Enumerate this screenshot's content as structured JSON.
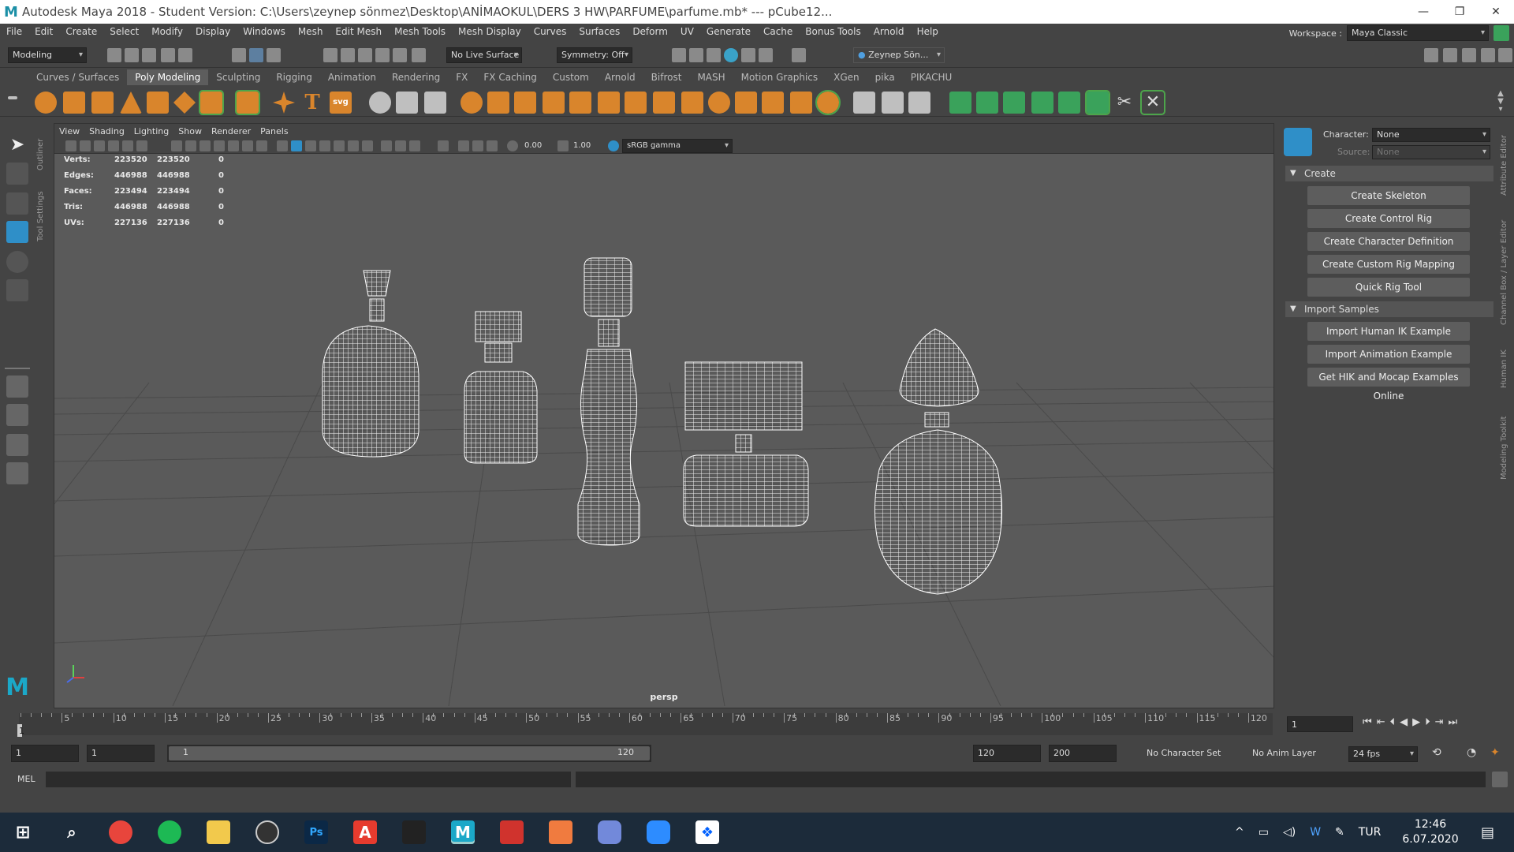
{
  "window": {
    "title": "Autodesk Maya 2018 - Student Version: C:\\Users\\zeynep sönmez\\Desktop\\ANİMAOKUL\\DERS 3 HW\\PARFUME\\parfume.mb*   ---   pCube12...",
    "logo": "M"
  },
  "menu": [
    "File",
    "Edit",
    "Create",
    "Select",
    "Modify",
    "Display",
    "Windows",
    "Mesh",
    "Edit Mesh",
    "Mesh Tools",
    "Mesh Display",
    "Curves",
    "Surfaces",
    "Deform",
    "UV",
    "Generate",
    "Cache",
    "Bonus Tools",
    "Arnold",
    "Help"
  ],
  "workspace": {
    "label": "Workspace :",
    "value": "Maya Classic"
  },
  "statusline": {
    "mode": "Modeling",
    "live_surface": "No Live Surface",
    "symmetry": "Symmetry: Off",
    "user": "Zeynep Sön..."
  },
  "shelf_tabs": [
    "Curves / Surfaces",
    "Poly Modeling",
    "Sculpting",
    "Rigging",
    "Animation",
    "Rendering",
    "FX",
    "FX Caching",
    "Custom",
    "Arnold",
    "Bifrost",
    "MASH",
    "Motion Graphics",
    "XGen",
    "pika",
    "PIKACHU"
  ],
  "shelf_active": "Poly Modeling",
  "left_vtabs": [
    "Outliner",
    "Tool Settings"
  ],
  "viewport": {
    "menu": [
      "View",
      "Shading",
      "Lighting",
      "Show",
      "Renderer",
      "Panels"
    ],
    "exposure": "0.00",
    "gamma": "1.00",
    "color_space": "sRGB gamma",
    "camera": "persp",
    "hud": [
      {
        "label": "Verts:",
        "a": "223520",
        "b": "223520",
        "c": "0"
      },
      {
        "label": "Edges:",
        "a": "446988",
        "b": "446988",
        "c": "0"
      },
      {
        "label": "Faces:",
        "a": "223494",
        "b": "223494",
        "c": "0"
      },
      {
        "label": "Tris:",
        "a": "446988",
        "b": "446988",
        "c": "0"
      },
      {
        "label": "UVs:",
        "a": "227136",
        "b": "227136",
        "c": "0"
      }
    ]
  },
  "humanik": {
    "character_label": "Character:",
    "character_value": "None",
    "source_label": "Source:",
    "source_value": "None",
    "create_header": "Create",
    "create_buttons": [
      "Create Skeleton",
      "Create Control Rig",
      "Create Character Definition",
      "Create Custom Rig Mapping",
      "Quick Rig Tool"
    ],
    "import_header": "Import Samples",
    "import_buttons": [
      "Import Human IK Example",
      "Import Animation Example",
      "Get HIK and Mocap Examples Online"
    ]
  },
  "right_vtabs": [
    "Attribute Editor",
    "Channel Box / Layer Editor",
    "Human IK",
    "Modeling Toolkit"
  ],
  "timeline": {
    "ticks": [
      "5",
      "10",
      "15",
      "20",
      "25",
      "30",
      "35",
      "40",
      "45",
      "50",
      "55",
      "60",
      "65",
      "70",
      "75",
      "80",
      "85",
      "90",
      "95",
      "100",
      "105",
      "110",
      "115",
      "120"
    ],
    "current_frame": "1",
    "current_field": "1"
  },
  "range": {
    "start": "1",
    "start2": "1",
    "slider_start": "1",
    "slider_end": "120",
    "end": "120",
    "end2": "200",
    "char_set": "No Character Set",
    "anim_layer": "No Anim Layer",
    "fps": "24 fps"
  },
  "cmdline": {
    "label": "MEL"
  },
  "taskbar": {
    "apps": [
      "windows-start",
      "search",
      "chrome",
      "spotify",
      "file-explorer",
      "obs",
      "photoshop",
      "acrobat",
      "unity",
      "maya",
      "sketchup",
      "ppt-app",
      "discord",
      "zoom",
      "dropbox"
    ],
    "lang": "TUR",
    "time": "12:46",
    "date": "6.07.2020"
  }
}
